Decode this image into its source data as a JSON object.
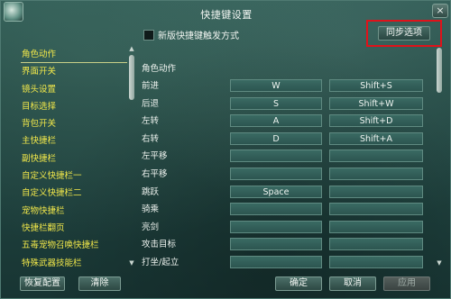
{
  "window": {
    "title": "快捷键设置",
    "close_label": "×"
  },
  "options": {
    "new_mode_label": "新版快捷键触发方式",
    "sync_label": "同步选项"
  },
  "categories": [
    "角色动作",
    "界面开关",
    "镜头设置",
    "目标选择",
    "背包开关",
    "主快捷栏",
    "副快捷栏",
    "自定义快捷栏一",
    "自定义快捷栏二",
    "宠物快捷栏",
    "快捷栏翻页",
    "五毒宠物召唤快捷栏",
    "特殊武器技能栏"
  ],
  "bindings": {
    "section": "角色动作",
    "rows": [
      {
        "action": "前进",
        "key1": "W",
        "key2": "Shift+S"
      },
      {
        "action": "后退",
        "key1": "S",
        "key2": "Shift+W"
      },
      {
        "action": "左转",
        "key1": "A",
        "key2": "Shift+D"
      },
      {
        "action": "右转",
        "key1": "D",
        "key2": "Shift+A"
      },
      {
        "action": "左平移",
        "key1": "",
        "key2": ""
      },
      {
        "action": "右平移",
        "key1": "",
        "key2": ""
      },
      {
        "action": "跳跃",
        "key1": "Space",
        "key2": ""
      },
      {
        "action": "骑乘",
        "key1": "",
        "key2": ""
      },
      {
        "action": "亮剑",
        "key1": "",
        "key2": ""
      },
      {
        "action": "攻击目标",
        "key1": "",
        "key2": ""
      },
      {
        "action": "打坐/起立",
        "key1": "",
        "key2": ""
      }
    ]
  },
  "buttons": {
    "reset": "恢复配置",
    "clear": "清除",
    "ok": "确定",
    "cancel": "取消",
    "apply": "应用"
  },
  "colors": {
    "category_text": "#f2e84a",
    "highlight_border": "#e0121a"
  }
}
